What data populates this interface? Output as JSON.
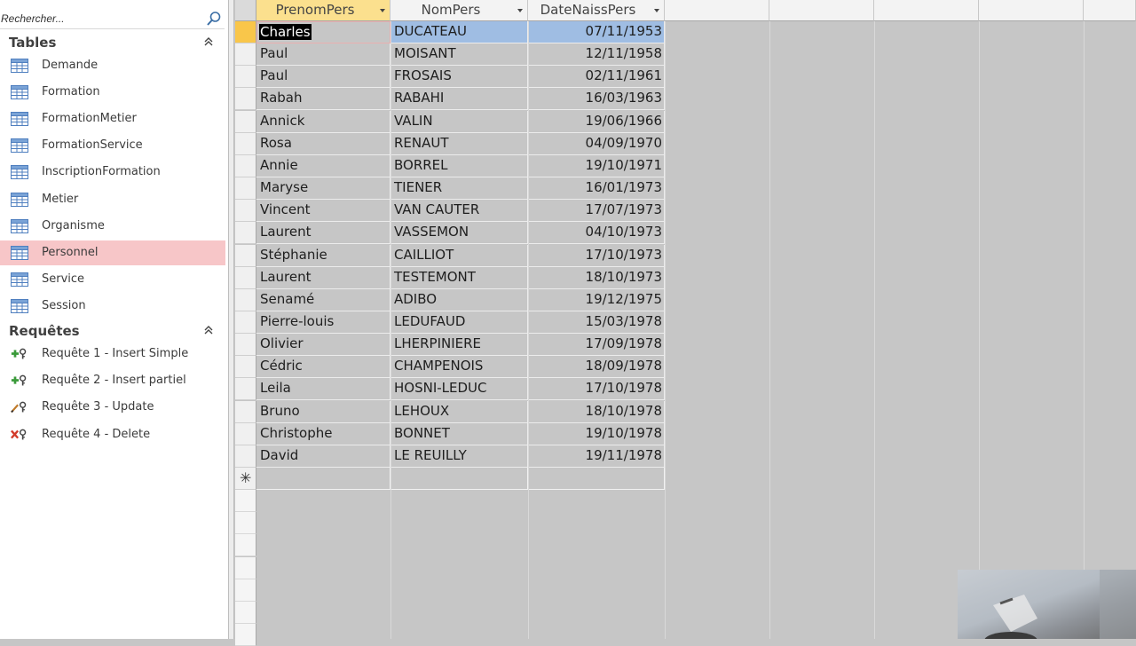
{
  "navigation": {
    "search_placeholder": "Rechercher...",
    "groups": {
      "tables": {
        "label": "Tables",
        "items": [
          {
            "label": "Demande",
            "selected": false
          },
          {
            "label": "Formation",
            "selected": false
          },
          {
            "label": "FormationMetier",
            "selected": false
          },
          {
            "label": "FormationService",
            "selected": false
          },
          {
            "label": "InscriptionFormation",
            "selected": false
          },
          {
            "label": "Metier",
            "selected": false
          },
          {
            "label": "Organisme",
            "selected": false
          },
          {
            "label": "Personnel",
            "selected": true
          },
          {
            "label": "Service",
            "selected": false
          },
          {
            "label": "Session",
            "selected": false
          }
        ]
      },
      "queries": {
        "label": "Requêtes",
        "items": [
          {
            "label": "Requête 1 - Insert Simple",
            "icon": "append-query-icon"
          },
          {
            "label": "Requête 2 - Insert partiel",
            "icon": "append-query-icon"
          },
          {
            "label": "Requête 3 - Update",
            "icon": "update-query-icon"
          },
          {
            "label": "Requête 4 - Delete",
            "icon": "delete-query-icon"
          }
        ]
      }
    }
  },
  "datasheet": {
    "columns": [
      {
        "label": "PrenomPers",
        "active": true
      },
      {
        "label": "NomPers",
        "active": false
      },
      {
        "label": "DateNaissPers",
        "active": false
      }
    ],
    "rows": [
      [
        "Charles",
        "DUCATEAU",
        "07/11/1953"
      ],
      [
        "Paul",
        "MOISANT",
        "12/11/1958"
      ],
      [
        "Paul",
        "FROSAIS",
        "02/11/1961"
      ],
      [
        "Rabah",
        "RABAHI",
        "16/03/1963"
      ],
      [
        "Annick",
        "VALIN",
        "19/06/1966"
      ],
      [
        "Rosa",
        "RENAUT",
        "04/09/1970"
      ],
      [
        "Annie",
        "BORREL",
        "19/10/1971"
      ],
      [
        "Maryse",
        "TIENER",
        "16/01/1973"
      ],
      [
        "Vincent",
        "VAN CAUTER",
        "17/07/1973"
      ],
      [
        "Laurent",
        "VASSEMON",
        "04/10/1973"
      ],
      [
        "Stéphanie",
        "CAILLIOT",
        "17/10/1973"
      ],
      [
        "Laurent",
        "TESTEMONT",
        "18/10/1973"
      ],
      [
        "Senamé",
        "ADIBO",
        "19/12/1975"
      ],
      [
        "Pierre-louis",
        "LEDUFAUD",
        "15/03/1978"
      ],
      [
        "Olivier",
        "LHERPINIERE",
        "17/09/1978"
      ],
      [
        "Cédric",
        "CHAMPENOIS",
        "18/09/1978"
      ],
      [
        "Leila",
        "HOSNI-LEDUC",
        "17/10/1978"
      ],
      [
        "Bruno",
        "LEHOUX",
        "18/10/1978"
      ],
      [
        "Christophe",
        "BONNET",
        "19/10/1978"
      ],
      [
        "David",
        "LE  REUILLY",
        "19/11/1978"
      ]
    ],
    "new_record_symbol": "✳"
  },
  "colors": {
    "selected_nav_item": "#f7c6c8",
    "active_header": "#fbe08e",
    "current_row_selector": "#f9c64a",
    "current_row_highlight": "#9fbde3",
    "datasheet_background": "#c6c6c6"
  }
}
